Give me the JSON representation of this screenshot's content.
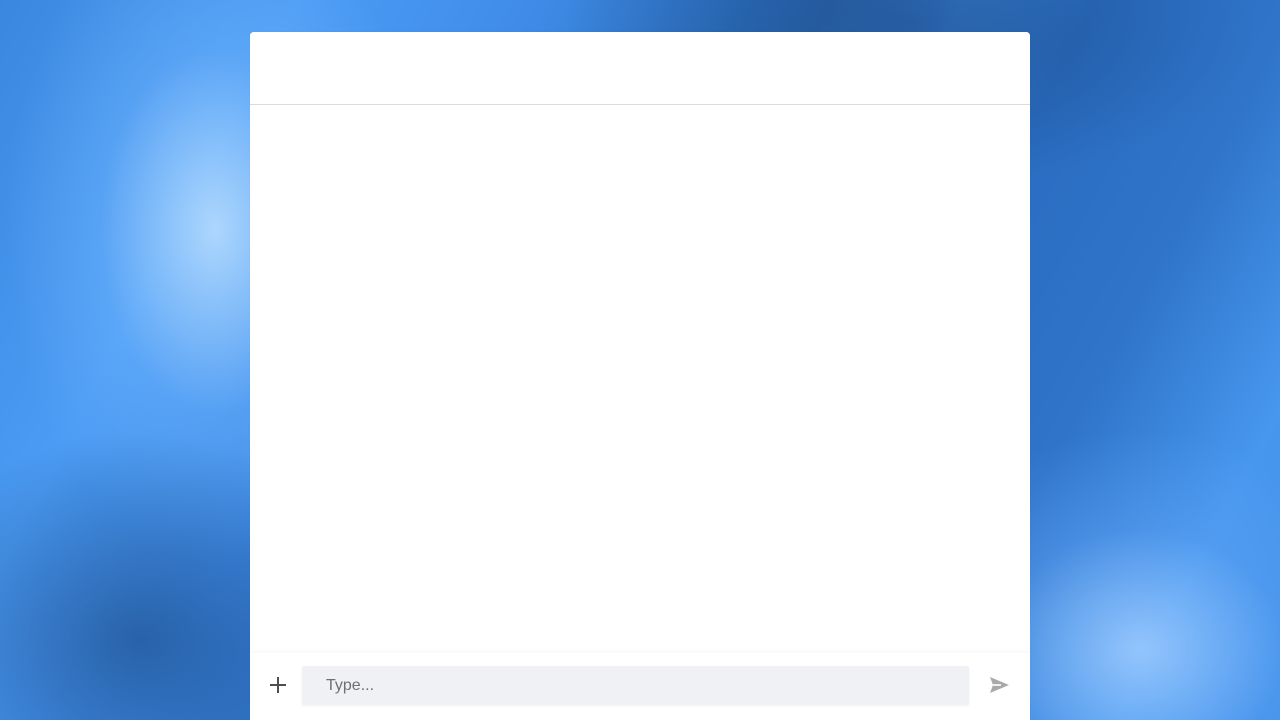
{
  "composer": {
    "input_value": "",
    "input_placeholder": "Type...",
    "attach_icon": "plus-icon",
    "send_icon": "send-icon"
  },
  "colors": {
    "window_background": "#ffffff",
    "input_background": "#eff1f5",
    "icon_dark": "#4f4f4f",
    "send_icon_disabled": "#a9a9a9",
    "wallpaper_primary": "#2f78cf"
  }
}
